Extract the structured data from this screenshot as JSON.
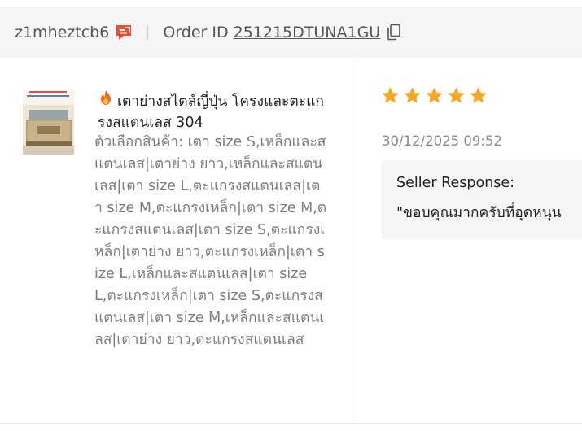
{
  "header": {
    "username": "z1mheztcb6",
    "order_label": "Order ID",
    "order_id": "251215DTUNA1GU",
    "chat_icon": "chat-icon",
    "copy_icon": "copy-icon"
  },
  "product": {
    "title": "เตาย่างสไตล์ญี่ปุ่น โครงและตะแกรงสแตนเลส 304",
    "title_icon": "fire-icon",
    "variation": "ตัวเลือกสินค้า: เตา size S,เหล็กและสแตนเลส|เตาย่าง ยาว,เหล็กและสแตนเลส|เตา size L,ตะแกรงสแตนเลส|เตา size M,ตะแกรงเหล็ก|เตา size M,ตะแกรงสแตนเลส|เตา size S,ตะแกรงเหล็ก|เตาย่าง ยาว,ตะแกรงเหล็ก|เตา size L,เหล็กและสแตนเลส|เตา size L,ตะแกรงเหล็ก|เตา size S,ตะแกรงสแตนเลส|เตา size M,เหล็กและสแตนเลส|เตาย่าง ยาว,ตะแกรงสแตนเลส"
  },
  "review": {
    "rating": 5,
    "max_rating": 5,
    "star_color": "#f5a623",
    "timestamp": "30/12/2025 09:52",
    "seller_response_label": "Seller Response:",
    "seller_response_text": "\"ขอบคุณมากครับที่อุดหนุน"
  },
  "colors": {
    "accent_orange": "#ee4d2d",
    "header_bg": "#f5f5f5",
    "text_muted": "#7d7d7d"
  }
}
